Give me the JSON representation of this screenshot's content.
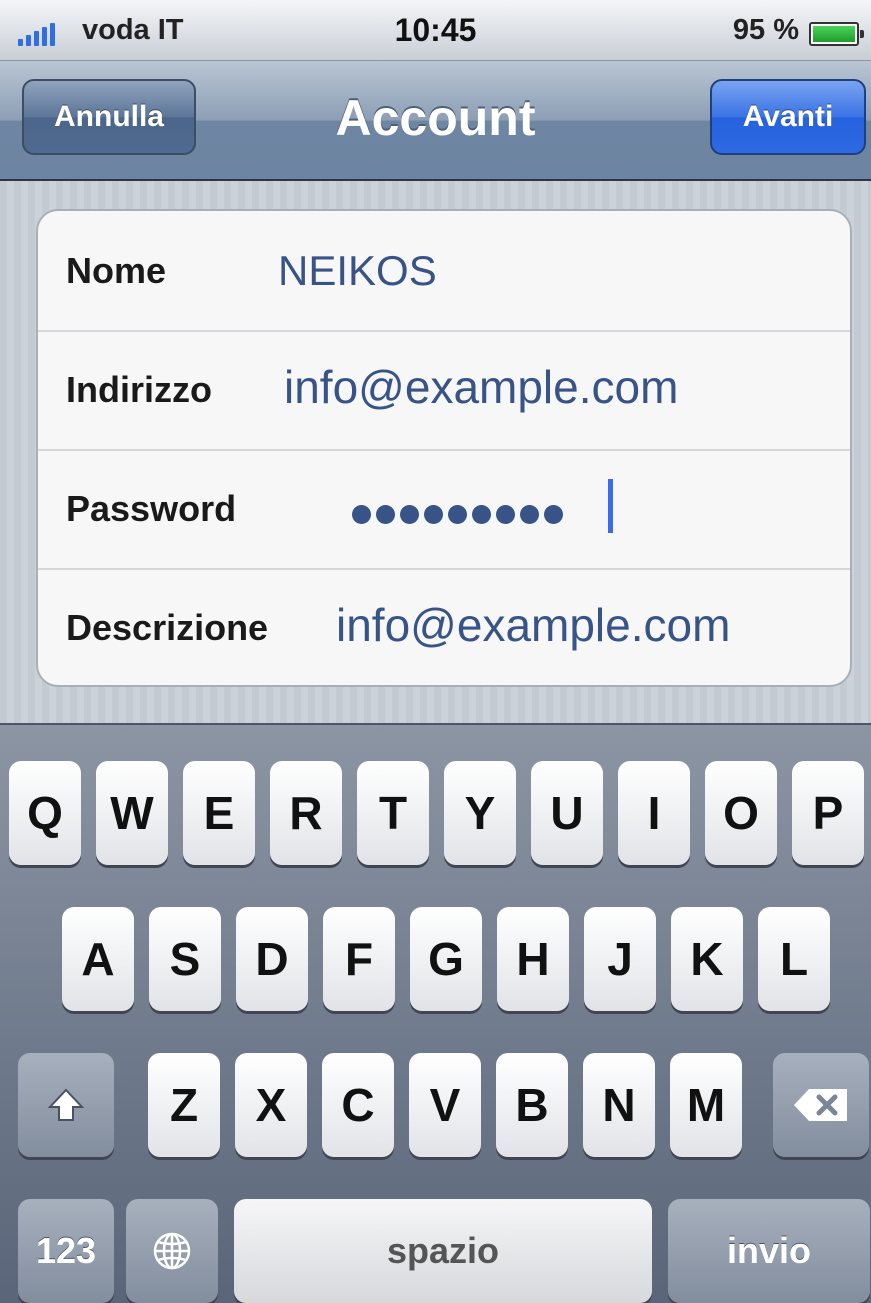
{
  "status": {
    "carrier": "voda IT",
    "time": "10:45",
    "battery": "95 %",
    "battery_level": 0.95,
    "signal_bars": 5
  },
  "nav": {
    "title": "Account",
    "cancel": "Annulla",
    "next": "Avanti"
  },
  "form": {
    "nome": {
      "label": "Nome",
      "value": "NEIKOS"
    },
    "indirizzo": {
      "label": "Indirizzo",
      "value": "info@example.com"
    },
    "password": {
      "label": "Password",
      "masked_length": 9
    },
    "descrizione": {
      "label": "Descrizione",
      "value": "info@example.com"
    }
  },
  "keyboard": {
    "row1": [
      "Q",
      "W",
      "E",
      "R",
      "T",
      "Y",
      "U",
      "I",
      "O",
      "P"
    ],
    "row2": [
      "A",
      "S",
      "D",
      "F",
      "G",
      "H",
      "J",
      "K",
      "L"
    ],
    "row3": [
      "Z",
      "X",
      "C",
      "V",
      "B",
      "N",
      "M"
    ],
    "numbers": "123",
    "space": "spazio",
    "return": "invio",
    "shift_icon": "shift-icon",
    "globe_icon": "globe-icon",
    "delete_icon": "delete-icon"
  }
}
